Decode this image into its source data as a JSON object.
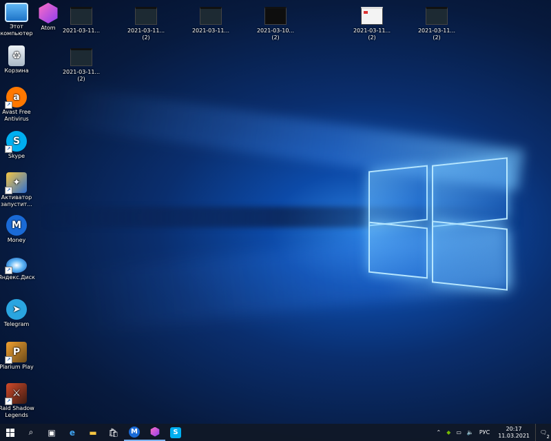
{
  "desktop_icons": [
    {
      "label": "Этот компьютер",
      "icon": "computer-icon"
    },
    {
      "label": "Atom",
      "icon": "atom-icon"
    },
    {
      "label": "Корзина",
      "icon": "recycle-bin-icon"
    },
    {
      "label": "Avast Free Antivirus",
      "icon": "avast-icon"
    },
    {
      "label": "Skype",
      "icon": "skype-icon"
    },
    {
      "label": "Активатор запустит...",
      "icon": "activator-icon"
    },
    {
      "label": "Money",
      "icon": "money-icon"
    },
    {
      "label": "Яндекс.Диск",
      "icon": "yandex-disk-icon"
    },
    {
      "label": "Telegram",
      "icon": "telegram-icon"
    },
    {
      "label": "Plarium Play",
      "icon": "plarium-icon"
    },
    {
      "label": "Raid Shadow Legends",
      "icon": "raid-icon"
    }
  ],
  "files": [
    {
      "name": "2021-03-11...",
      "count": ""
    },
    {
      "name": "2021-03-11...",
      "count": "(2)"
    },
    {
      "name": "2021-03-11...",
      "count": ""
    },
    {
      "name": "2021-03-10...",
      "count": "(2)"
    },
    {
      "name": "2021-03-11...",
      "count": "(2)"
    },
    {
      "name": "2021-03-11...",
      "count": "(2)"
    },
    {
      "name": "2021-03-11...",
      "count": "(2)"
    }
  ],
  "taskbar": {
    "items": [
      "windows-start",
      "search",
      "task-view",
      "edge",
      "file-explorer",
      "store",
      "money",
      "atom",
      "skype"
    ],
    "tray": {
      "language": "РУС",
      "time": "20:17",
      "date": "11.03.2021",
      "notifications": "2"
    }
  }
}
